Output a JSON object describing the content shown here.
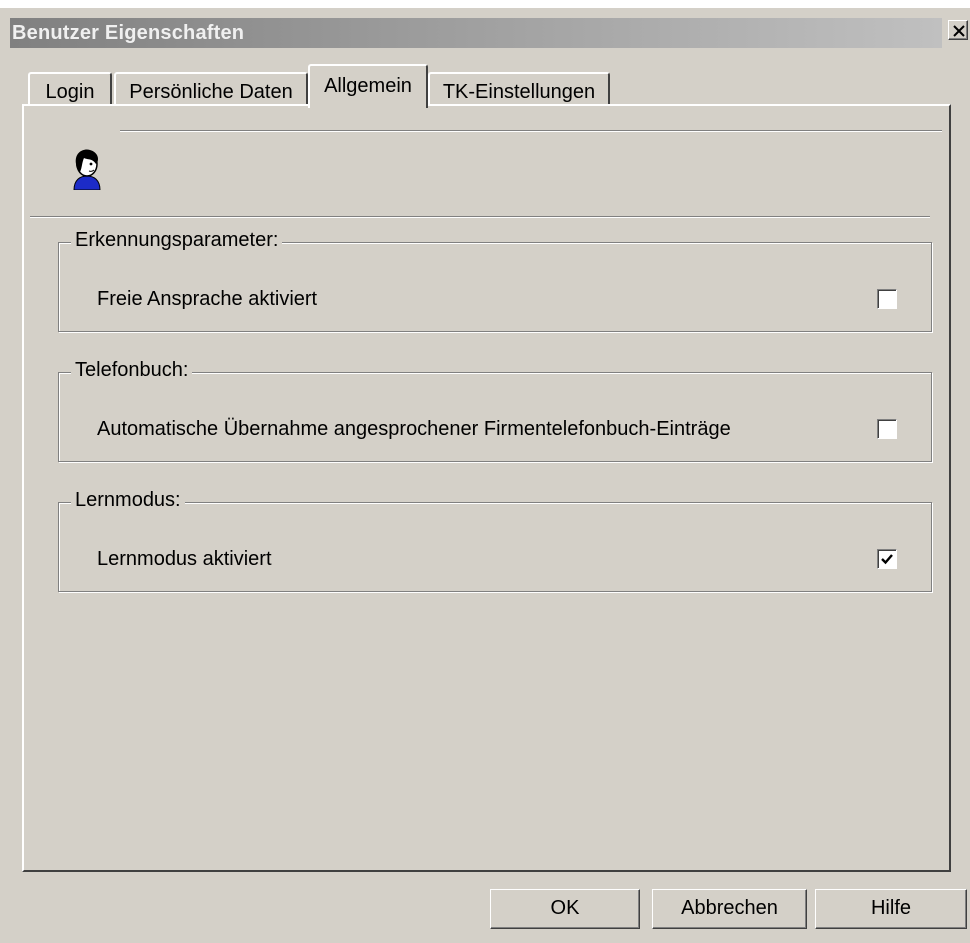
{
  "window": {
    "title": "Benutzer Eigenschaften",
    "close_label": "X"
  },
  "tabs": [
    {
      "label": "Login",
      "active": false
    },
    {
      "label": "Persönliche Daten",
      "active": false
    },
    {
      "label": "Allgemein",
      "active": true
    },
    {
      "label": "TK-Einstellungen",
      "active": false
    }
  ],
  "header": {
    "icon": "user-icon"
  },
  "groups": {
    "recognition": {
      "title": "Erkennungsparameter:",
      "option_label": "Freie Ansprache aktiviert",
      "checked": false
    },
    "phonebook": {
      "title": "Telefonbuch:",
      "option_label": "Automatische Übernahme angesprochener Firmentelefonbuch-Einträge",
      "checked": false
    },
    "learning": {
      "title": "Lernmodus:",
      "option_label": "Lernmodus aktiviert",
      "checked": true
    }
  },
  "buttons": {
    "ok": "OK",
    "cancel": "Abbrechen",
    "help": "Hilfe"
  },
  "colors": {
    "face": "#d4d0c8",
    "highlight": "#ffffff",
    "shadow": "#808080",
    "dark_shadow": "#404040",
    "title_gradient_start": "#808080",
    "title_gradient_end": "#c0c0c0",
    "icon_blue": "#1c2bc8"
  }
}
